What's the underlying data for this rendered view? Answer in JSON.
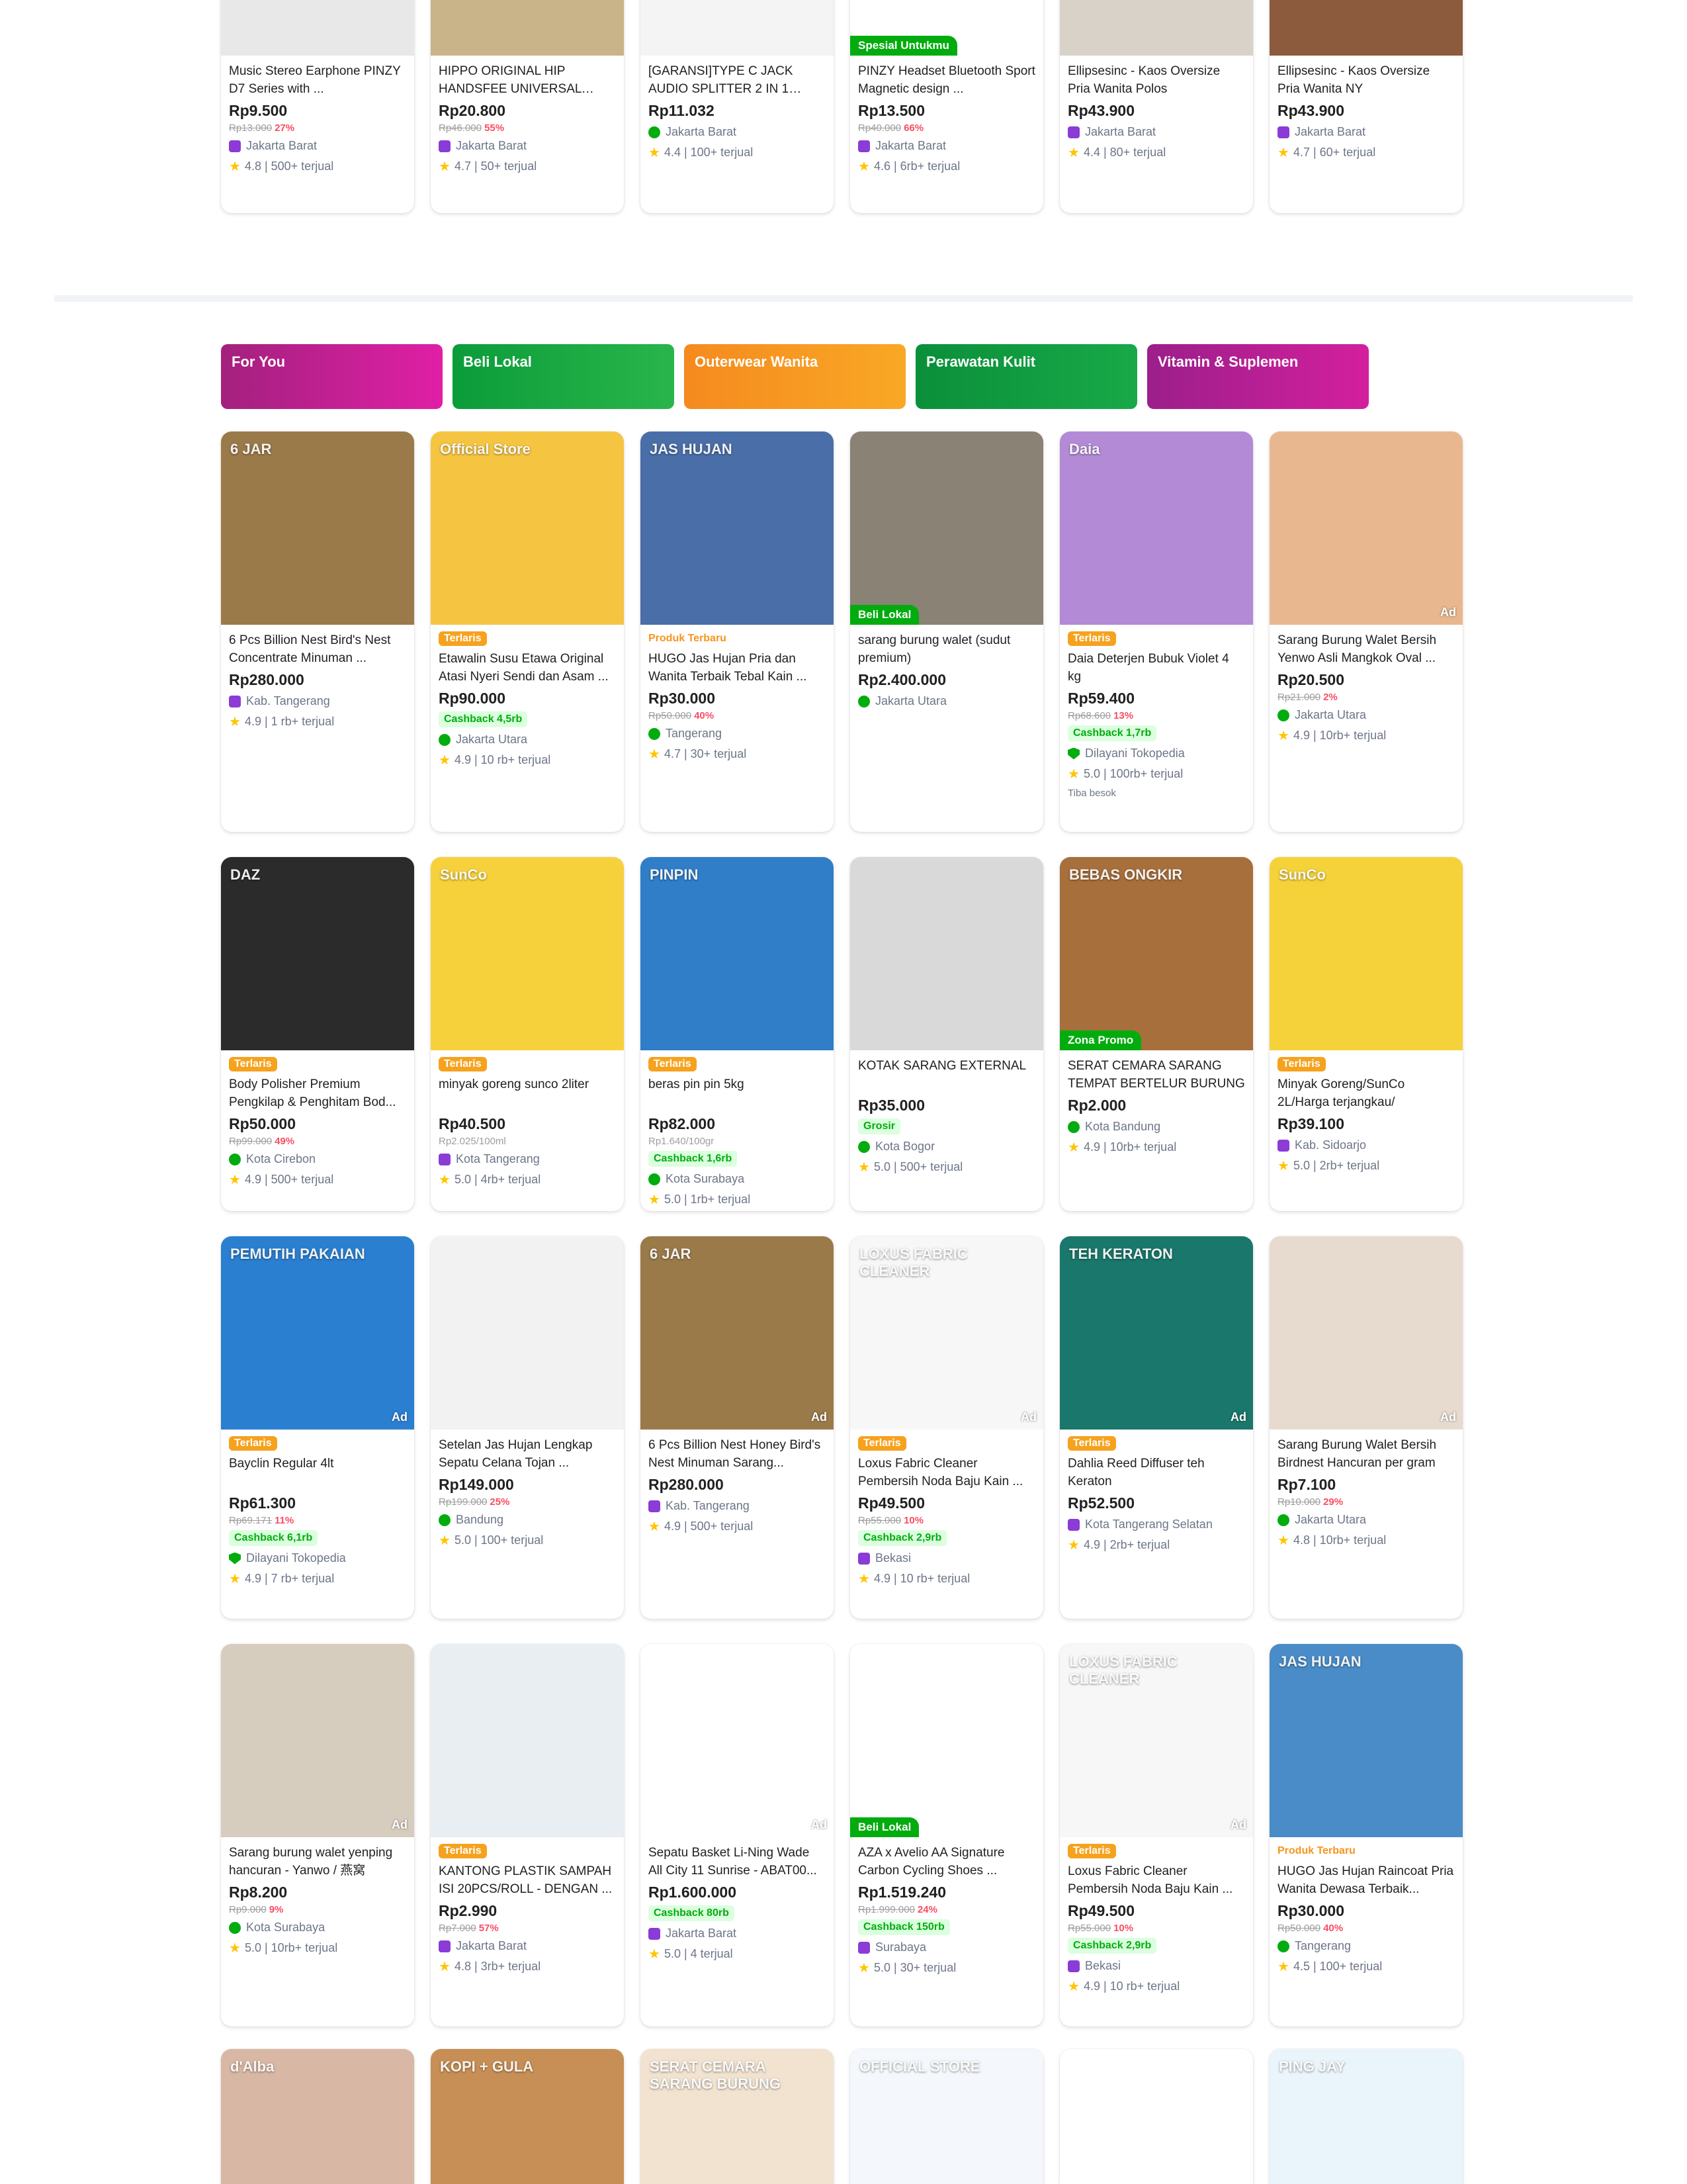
{
  "top_row": [
    {
      "name": "Music Stereo Earphone PINZY D7 Series with ...",
      "price": "Rp9.500",
      "orig": "Rp13.000",
      "disc": "27%",
      "shop": "Jakarta Barat",
      "badge": "os",
      "rating": "4.8 | 500+ terjual",
      "img": "#e8e8e8"
    },
    {
      "name": "HIPPO ORIGINAL HIP HANDSFEE UNIVERSAL BAS...",
      "price": "Rp20.800",
      "orig": "Rp46.000",
      "disc": "55%",
      "shop": "Jakarta Barat",
      "badge": "os",
      "rating": "4.7 | 50+ terjual",
      "img": "#c9b48a"
    },
    {
      "name": "[GARANSI]TYPE C JACK AUDIO SPLITTER 2 IN 1 JAC...",
      "price": "Rp11.032",
      "shop": "Jakarta Barat",
      "badge": "pm",
      "rating": "4.4 | 100+ terjual",
      "img": "#f4f4f4"
    },
    {
      "label": "Spesial Untukmu",
      "name": "PINZY Headset Bluetooth Sport Magnetic design ...",
      "price": "Rp13.500",
      "orig": "Rp40.000",
      "disc": "66%",
      "shop": "Jakarta Barat",
      "badge": "os",
      "rating": "4.6 | 6rb+ terjual",
      "img": "#ffffff"
    },
    {
      "name": "Ellipsesinc - Kaos Oversize Pria Wanita Polos",
      "price": "Rp43.900",
      "shop": "Jakarta Barat",
      "badge": "os",
      "rating": "4.4 | 80+ terjual",
      "img": "#d8d2c8"
    },
    {
      "name": "Ellipsesinc - Kaos Oversize Pria Wanita NY",
      "price": "Rp43.900",
      "shop": "Jakarta Barat",
      "badge": "os",
      "rating": "4.7 | 60+ terjual",
      "img": "#8c5a3c"
    }
  ],
  "tabs": [
    {
      "label": "For You",
      "from": "#a3217e",
      "to": "#e01fa6"
    },
    {
      "label": "Beli Lokal",
      "from": "#0b9c3a",
      "to": "#29b54a"
    },
    {
      "label": "Outerwear Wanita",
      "from": "#f58a1f",
      "to": "#f9a825"
    },
    {
      "label": "Perawatan Kulit",
      "from": "#0b8f3a",
      "to": "#18a948"
    },
    {
      "label": "Vitamin & Suplemen",
      "from": "#9b1f8a",
      "to": "#d41f9f"
    }
  ],
  "products": [
    {
      "name": "6 Pcs Billion Nest Bird's Nest Concentrate Minuman ...",
      "price": "Rp280.000",
      "shop": "Kab. Tangerang",
      "badge": "os",
      "rating": "4.9 | 1 rb+ terjual",
      "img": "#9b7a4a",
      "imgtext": "6 JAR"
    },
    {
      "label": "Terlaris",
      "ltype": "terlaris",
      "name": "Etawalin Susu Etawa Original Atasi Nyeri Sendi dan Asam ...",
      "price": "Rp90.000",
      "cashback": "Cashback 4,5rb",
      "shop": "Jakarta Utara",
      "badge": "pm",
      "rating": "4.9 | 10 rb+ terjual",
      "img": "#f5c542",
      "imgtext": "Official Store"
    },
    {
      "label": "Produk Terbaru",
      "ltype": "terbaru",
      "name": "HUGO Jas Hujan Pria dan Wanita Terbaik Tebal Kain ...",
      "price": "Rp30.000",
      "orig": "Rp50.000",
      "disc": "40%",
      "shop": "Tangerang",
      "badge": "pm",
      "rating": "4.7 | 30+ terjual",
      "img": "#4a6ea8",
      "imgtext": "JAS HUJAN"
    },
    {
      "label": "Beli Lokal",
      "ltype": "ribbon",
      "name": "sarang burung walet (sudut premium)",
      "price": "Rp2.400.000",
      "shop": "Jakarta Utara",
      "badge": "pm",
      "img": "#8a8274"
    },
    {
      "label": "Terlaris",
      "ltype": "terlaris",
      "name": "Daia Deterjen Bubuk Violet 4 kg",
      "price": "Rp59.400",
      "orig": "Rp68.600",
      "disc": "13%",
      "cashback": "Cashback 1,7rb",
      "shop": "Dilayani Tokopedia",
      "badge": "dl",
      "rating": "5.0 | 100rb+ terjual",
      "extra": "Tiba besok",
      "img": "#b28ad6",
      "imgtext": "Daia"
    },
    {
      "name": "Sarang Burung Walet Bersih Yenwo Asli Mangkok Oval ...",
      "price": "Rp20.500",
      "orig": "Rp21.000",
      "disc": "2%",
      "shop": "Jakarta Utara",
      "badge": "pm",
      "rating": "4.9 | 10rb+ terjual",
      "img": "#e9b78f",
      "ad": "Ad"
    },
    {
      "label": "Terlaris",
      "ltype": "terlaris",
      "name": "Body Polisher Premium Pengkilap & Penghitam Bod...",
      "price": "Rp50.000",
      "orig": "Rp99.000",
      "disc": "49%",
      "shop": "Kota Cirebon",
      "badge": "pm",
      "rating": "4.9 | 500+ terjual",
      "img": "#2b2b2b",
      "imgtext": "DAZ"
    },
    {
      "label": "Terlaris",
      "ltype": "terlaris",
      "name": "minyak goreng sunco 2liter",
      "price": "Rp40.500",
      "unit": "Rp2.025/100ml",
      "shop": "Kota Tangerang",
      "badge": "os",
      "rating": "5.0 | 4rb+ terjual",
      "img": "#f7d13b",
      "imgtext": "SunCo"
    },
    {
      "label": "Terlaris",
      "ltype": "terlaris",
      "name": "beras pin pin 5kg",
      "price": "Rp82.000",
      "unit": "Rp1.640/100gr",
      "cashback": "Cashback 1,6rb",
      "shop": "Kota Surabaya",
      "badge": "pm",
      "rating": "5.0 | 1rb+ terjual",
      "img": "#2f7ec7",
      "imgtext": "PINPIN"
    },
    {
      "name": "KOTAK SARANG EXTERNAL",
      "price": "Rp35.000",
      "cashback": "Grosir",
      "shop": "Kota Bogor",
      "badge": "pm",
      "rating": "5.0 | 500+ terjual",
      "img": "#d9d9d9"
    },
    {
      "label": "Zona Promo",
      "ltype": "ribbon",
      "name": "SERAT CEMARA SARANG TEMPAT BERTELUR BURUNG",
      "price": "Rp2.000",
      "shop": "Kota Bandung",
      "badge": "pm",
      "rating": "4.9 | 10rb+ terjual",
      "img": "#a76f3b",
      "imgtext": "BEBAS ONGKIR"
    },
    {
      "label": "Terlaris",
      "ltype": "terlaris",
      "name": "Minyak Goreng/SunCo 2L/Harga terjangkau/",
      "price": "Rp39.100",
      "shop": "Kab. Sidoarjo",
      "badge": "os",
      "rating": "5.0 | 2rb+ terjual",
      "img": "#f5d23a",
      "imgtext": "SunCo"
    },
    {
      "label": "Terlaris",
      "ltype": "terlaris",
      "name": "Bayclin Regular 4lt",
      "price": "Rp61.300",
      "orig": "Rp69.171",
      "disc": "11%",
      "cashback": "Cashback 6,1rb",
      "shop": "Dilayani Tokopedia",
      "badge": "dl",
      "rating": "4.9 | 7 rb+ terjual",
      "img": "#2a7fd0",
      "imgtext": "PEMUTIH PAKAIAN",
      "ad": "Ad"
    },
    {
      "name": "Setelan Jas Hujan Lengkap Sepatu Celana Tojan ...",
      "price": "Rp149.000",
      "orig": "Rp199.000",
      "disc": "25%",
      "shop": "Bandung",
      "badge": "pm",
      "rating": "5.0 | 100+ terjual",
      "img": "#f2f2f2"
    },
    {
      "name": "6 Pcs Billion Nest Honey Bird's Nest Minuman Sarang...",
      "price": "Rp280.000",
      "shop": "Kab. Tangerang",
      "badge": "os",
      "rating": "4.9 | 500+ terjual",
      "img": "#9b7a4a",
      "imgtext": "6 JAR",
      "ad": "Ad"
    },
    {
      "label": "Terlaris",
      "ltype": "terlaris",
      "name": "Loxus Fabric Cleaner Pembersih Noda Baju Kain ...",
      "price": "Rp49.500",
      "orig": "Rp55.000",
      "disc": "10%",
      "cashback": "Cashback 2,9rb",
      "shop": "Bekasi",
      "badge": "os",
      "rating": "4.9 | 10 rb+ terjual",
      "img": "#f7f7f7",
      "imgtext": "LOXUS FABRIC CLEANER",
      "ad": "Ad"
    },
    {
      "label": "Terlaris",
      "ltype": "terlaris",
      "name": "Dahlia Reed Diffuser teh Keraton",
      "price": "Rp52.500",
      "shop": "Kota Tangerang Selatan",
      "badge": "os",
      "rating": "4.9 | 2rb+ terjual",
      "img": "#19776b",
      "imgtext": "TEH KERATON",
      "ad": "Ad"
    },
    {
      "name": "Sarang Burung Walet Bersih Birdnest Hancuran per gram",
      "price": "Rp7.100",
      "orig": "Rp10.000",
      "disc": "29%",
      "shop": "Jakarta Utara",
      "badge": "pm",
      "rating": "4.8 | 10rb+ terjual",
      "img": "#e7dbcf",
      "ad": "Ad"
    },
    {
      "name": "Sarang burung walet yenping hancuran - Yanwo / 燕窝",
      "price": "Rp8.200",
      "orig": "Rp9.000",
      "disc": "9%",
      "shop": "Kota Surabaya",
      "badge": "pm",
      "rating": "5.0 | 10rb+ terjual",
      "img": "#d6cdbf",
      "ad": "Ad"
    },
    {
      "label": "Terlaris",
      "ltype": "terlaris",
      "name": "KANTONG PLASTIK SAMPAH ISI 20PCS/ROLL - DENGAN ...",
      "price": "Rp2.990",
      "orig": "Rp7.000",
      "disc": "57%",
      "shop": "Jakarta Barat",
      "badge": "os",
      "rating": "4.8 | 3rb+ terjual",
      "img": "#e9eef3"
    },
    {
      "name": "Sepatu Basket Li-Ning Wade All City 11 Sunrise - ABAT00...",
      "price": "Rp1.600.000",
      "cashback": "Cashback 80rb",
      "shop": "Jakarta Barat",
      "badge": "os",
      "rating": "5.0 | 4 terjual",
      "img": "#ffffff",
      "ad": "Ad"
    },
    {
      "label": "Beli Lokal",
      "ltype": "ribbon",
      "name": "AZA x Avelio AA Signature Carbon Cycling Shoes ...",
      "price": "Rp1.519.240",
      "orig": "Rp1.999.000",
      "disc": "24%",
      "cashback": "Cashback 150rb",
      "shop": "Surabaya",
      "badge": "os",
      "rating": "5.0 | 30+ terjual",
      "img": "#ffffff"
    },
    {
      "label": "Terlaris",
      "ltype": "terlaris",
      "name": "Loxus Fabric Cleaner Pembersih Noda Baju Kain ...",
      "price": "Rp49.500",
      "orig": "Rp55.000",
      "disc": "10%",
      "cashback": "Cashback 2,9rb",
      "shop": "Bekasi",
      "badge": "os",
      "rating": "4.9 | 10 rb+ terjual",
      "img": "#f7f7f7",
      "imgtext": "LOXUS FABRIC CLEANER",
      "ad": "Ad"
    },
    {
      "label": "Produk Terbaru",
      "ltype": "terbaru",
      "name": "HUGO Jas Hujan Raincoat Pria Wanita Dewasa Terbaik...",
      "price": "Rp30.000",
      "orig": "Rp50.000",
      "disc": "40%",
      "shop": "Tangerang",
      "badge": "pm",
      "rating": "4.5 | 100+ terjual",
      "img": "#4a8cc7",
      "imgtext": "JAS HUJAN"
    }
  ],
  "bottom_row": [
    {
      "img": "#d8b7a4",
      "imgtext": "d'Alba"
    },
    {
      "img": "#c78f55",
      "imgtext": "KOPI + GULA"
    },
    {
      "img": "#f2e3d0",
      "imgtext": "SERAT CEMARA SARANG BURUNG"
    },
    {
      "img": "#f4f7fb",
      "imgtext": "OFFICIAL STORE"
    },
    {
      "img": "#ffffff"
    },
    {
      "img": "#eaf4fb",
      "imgtext": "PING JAY"
    }
  ]
}
